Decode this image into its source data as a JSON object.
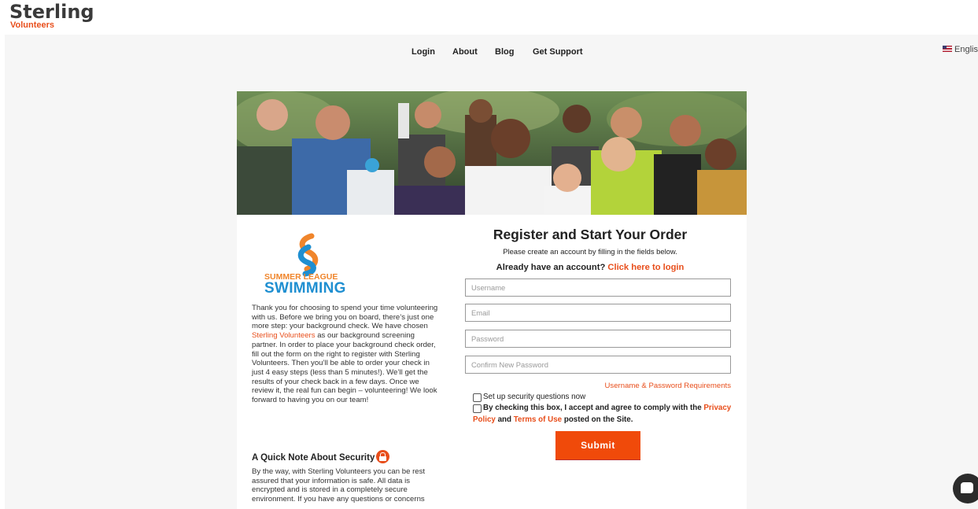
{
  "brand": {
    "logo_main": "Sterling",
    "logo_sub": "Volunteers"
  },
  "nav": {
    "items": [
      {
        "label": "Login"
      },
      {
        "label": "About"
      },
      {
        "label": "Blog"
      },
      {
        "label": "Get Support"
      }
    ],
    "language": "English"
  },
  "partner": {
    "line1": "SUMMER LEAGUE",
    "line2": "SWIMMING"
  },
  "intro": {
    "before_link": "Thank you for choosing to spend your time volunteering with us. Before we bring you on board, there’s just one more step: your background check. We have chosen ",
    "link": "Sterling Volunteers",
    "after_link": " as our background screening partner. In order to place your background check order, fill out the form on the right to register with Sterling Volunteers. Then you’ll be able to order your check in just 4 easy steps (less than 5 minutes!). We’ll get the results of your check back in a few days. Once we review it, the real fun can begin – volunteering! We look forward to having you on our team!"
  },
  "security": {
    "title": "A Quick Note About Security",
    "body": "By the way, with Sterling Volunteers you can be rest assured that your information is safe. All data is encrypted and is stored in a completely secure environment. If you have any questions or concerns"
  },
  "register": {
    "title": "Register and Start Your Order",
    "subtitle": "Please create an account by filling in the fields below.",
    "have_account": "Already have an account?",
    "login_link": "Click here to login",
    "fields": {
      "username": {
        "placeholder": "Username",
        "value": ""
      },
      "email": {
        "placeholder": "Email",
        "value": ""
      },
      "password": {
        "placeholder": "Password",
        "value": ""
      },
      "confirm": {
        "placeholder": "Confirm New Password",
        "value": ""
      }
    },
    "requirements_link": "Username & Password Requirements",
    "cb_security": "Set up security questions now",
    "cb_terms_1": "By checking this box, I accept and agree to comply with the",
    "privacy_word1": "Privacy",
    "privacy_word2": "Policy",
    "and": "and",
    "terms_link": "Terms of Use",
    "posted": "posted on the Site.",
    "submit": "Submit"
  },
  "colors": {
    "accent": "#e84e1b",
    "submit": "#f04a0a",
    "partner_orange": "#f0852b",
    "partner_blue": "#1f8fd1"
  },
  "icons": {
    "flag": "us-flag-icon",
    "lock": "lock-icon",
    "chat": "chat-icon"
  }
}
